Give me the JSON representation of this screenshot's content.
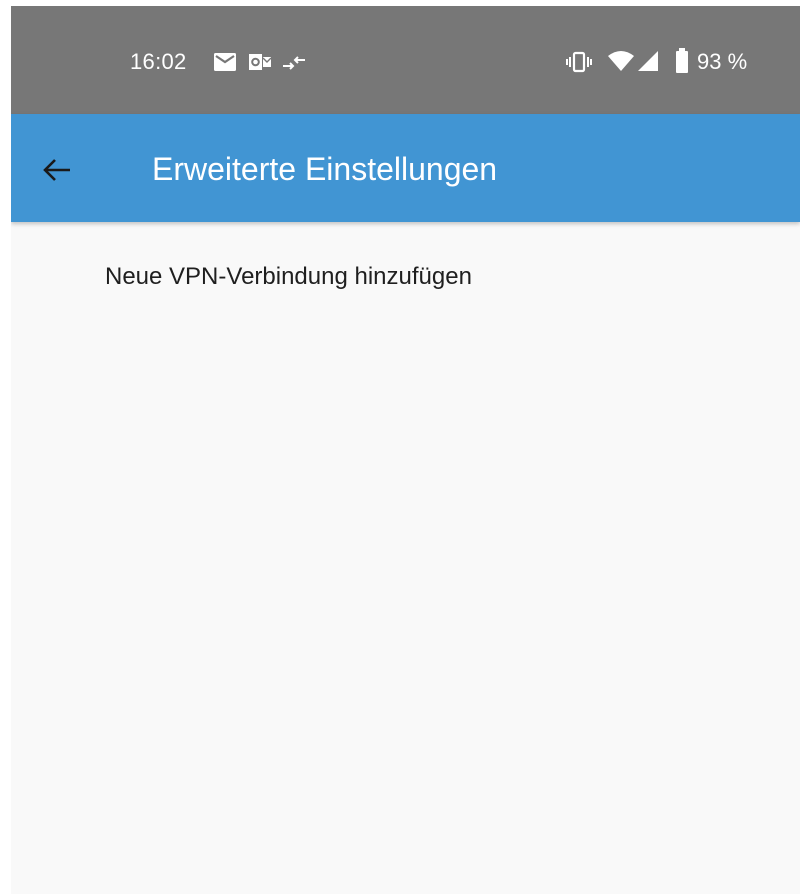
{
  "status_bar": {
    "time": "16:02",
    "battery_percent": "93 %",
    "notification_icons": [
      "mail-icon",
      "outlook-icon",
      "data-transfer-icon"
    ],
    "system_icons": [
      "vibrate-icon",
      "wifi-icon",
      "cellular-signal-icon",
      "battery-icon"
    ]
  },
  "app_bar": {
    "title": "Erweiterte Einstellungen",
    "back_icon": "arrow-back-icon",
    "color": "#4195d3"
  },
  "list": {
    "items": [
      {
        "label": "Neue VPN-Verbindung hinzufügen"
      }
    ]
  }
}
